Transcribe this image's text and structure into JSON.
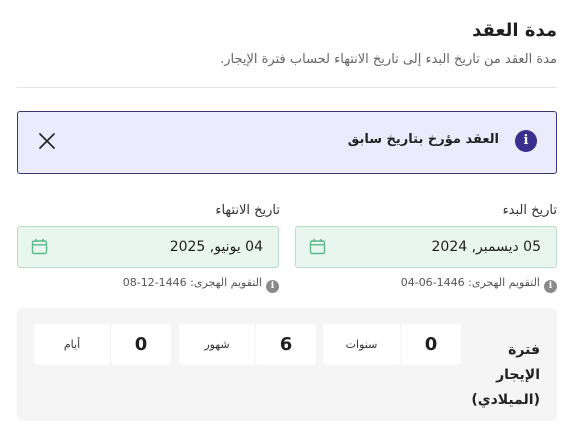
{
  "section": {
    "title": "مدة العقد",
    "subtitle": "مدة العقد من تاريخ البدء إلى تاريخ الانتهاء لحساب فترة الإيجار."
  },
  "alert": {
    "text": "العقد مؤرخ بتاريخ سابق",
    "icon": "info-icon",
    "close_icon": "close-icon"
  },
  "start": {
    "label": "تاريخ البدء",
    "date": "05 ديسمبر, 2024",
    "hijri": "التقويم الهجرى: 1446-06-04",
    "icon": "calendar-icon"
  },
  "end": {
    "label": "تاريخ الانتهاء",
    "date": "04 يونيو, 2025",
    "hijri": "التقويم الهجرى: 1446-12-08",
    "icon": "calendar-icon"
  },
  "period": {
    "label": "فترة الإيجار (الميلادي)",
    "years_value": "0",
    "years_unit": "سنوات",
    "months_value": "6",
    "months_unit": "شهور",
    "days_value": "0",
    "days_unit": "أيام"
  },
  "colors": {
    "accent": "#3b2f8e",
    "alert_bg": "#ecebfd",
    "date_bg": "#e9f6ef",
    "calendar_icon": "#5cb887"
  }
}
